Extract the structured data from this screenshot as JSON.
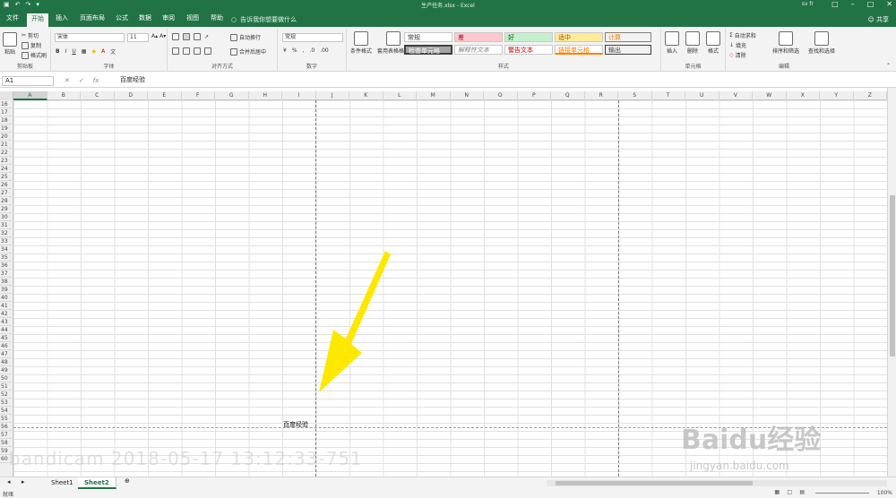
{
  "app": {
    "doc_title": "生产任务.xlsx - Excel",
    "user": "sv fr",
    "share": "共享"
  },
  "colors": {
    "accent": "#217346",
    "arrow": "#ffe800"
  },
  "menu": {
    "tabs": [
      "文件",
      "开始",
      "插入",
      "页面布局",
      "公式",
      "数据",
      "审阅",
      "视图",
      "帮助"
    ],
    "active_tab": "开始",
    "search": "告诉我你想要做什么"
  },
  "ribbon": {
    "clipboard": {
      "paste": "粘贴",
      "cut": "剪切",
      "copy": "复制",
      "format_painter": "格式刷",
      "label": "剪贴板"
    },
    "font": {
      "name": "宋体",
      "size": "11",
      "label": "字体",
      "bold": "B",
      "italic": "I",
      "underline": "U"
    },
    "alignment": {
      "wrap": "自动换行",
      "merge": "合并后居中",
      "label": "对齐方式"
    },
    "number": {
      "format": "常规",
      "percent": "%",
      "comma": ",",
      "label": "数字"
    },
    "styles": {
      "cond_format": "条件格式",
      "table_format": "套用表格格式",
      "items": [
        "常规",
        "差",
        "好",
        "适中",
        "计算",
        "检查单元格",
        "解释性文本",
        "警告文本",
        "链接单元格",
        "输出"
      ],
      "label": "样式"
    },
    "cells": {
      "insert": "插入",
      "delete": "删除",
      "format": "格式",
      "label": "单元格"
    },
    "editing": {
      "autosum": "自动求和",
      "fill": "填充",
      "clear": "清除",
      "sort": "排序和筛选",
      "find": "查找和选择",
      "label": "编辑"
    }
  },
  "formula_bar": {
    "name_box": "A1",
    "fx": "fx",
    "content": "百度经验"
  },
  "columns": [
    "A",
    "B",
    "C",
    "D",
    "E",
    "F",
    "G",
    "H",
    "I",
    "J",
    "K",
    "L",
    "M",
    "N",
    "O",
    "P",
    "Q",
    "R",
    "S",
    "T",
    "U",
    "V",
    "W",
    "X",
    "Y",
    "Z"
  ],
  "rows": [
    "16",
    "17",
    "18",
    "19",
    "20",
    "21",
    "22",
    "23",
    "24",
    "25",
    "26",
    "27",
    "28",
    "29",
    "30",
    "31",
    "32",
    "33",
    "34",
    "35",
    "36",
    "37",
    "38",
    "39",
    "40",
    "41",
    "42",
    "43",
    "44",
    "45",
    "46",
    "47",
    "48",
    "49",
    "50",
    "51",
    "52",
    "53",
    "54",
    "55",
    "56",
    "57",
    "58",
    "59",
    "60"
  ],
  "cell_text": "百度经验",
  "sheets": [
    "Sheet1",
    "Sheet2"
  ],
  "active_sheet": "Sheet2",
  "status": {
    "left": "就绪",
    "zoom": "100%"
  },
  "watermarks": {
    "bandicam": "bandicam 2018-05-17 13:12:33-751",
    "baidu": "Baidu经验",
    "baidu_url": "jingyan.baidu.com"
  }
}
